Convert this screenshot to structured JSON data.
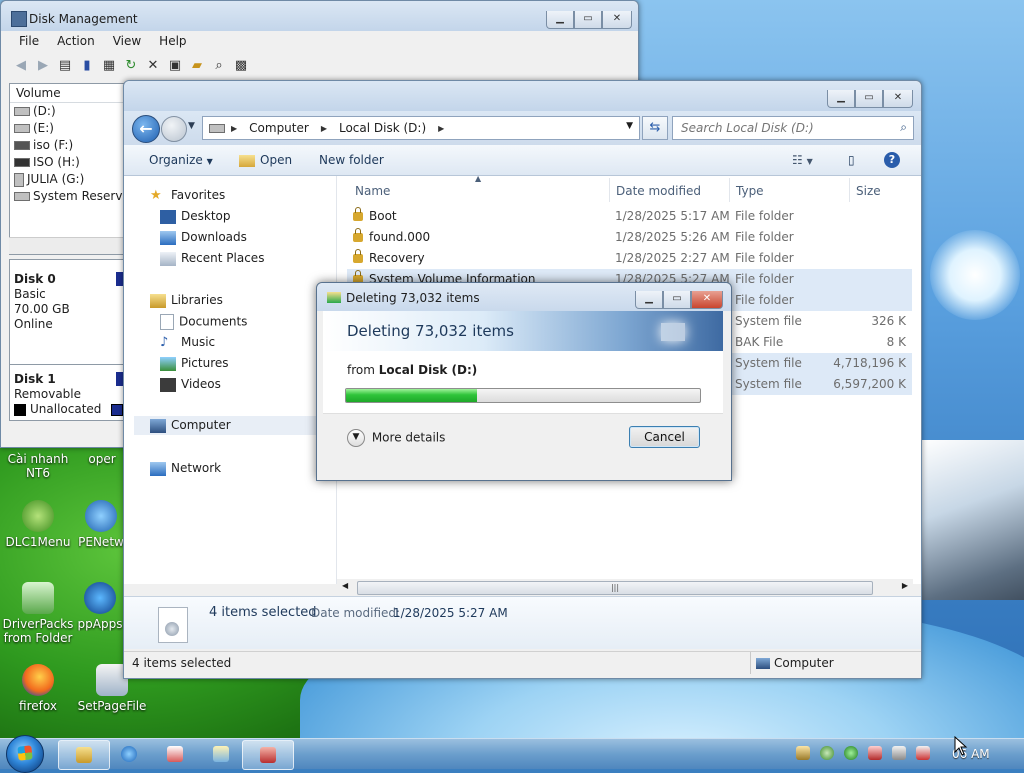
{
  "disk_management": {
    "title": "Disk Management",
    "menu": [
      "File",
      "Action",
      "View",
      "Help"
    ],
    "volume_header": "Volume",
    "volumes": [
      "(D:)",
      "(E:)",
      "iso (F:)",
      "ISO (H:)",
      "JULIA (G:)",
      "System Reserved"
    ],
    "disk0": {
      "name": "Disk 0",
      "type": "Basic",
      "size": "70.00 GB",
      "status": "Online"
    },
    "disk1": {
      "name": "Disk 1",
      "type": "Removable"
    },
    "legend_unallocated": "Unallocated",
    "legend_p": "P"
  },
  "explorer": {
    "breadcrumb": [
      "Computer",
      "Local Disk (D:)"
    ],
    "search_placeholder": "Search Local Disk (D:)",
    "commands": {
      "organize": "Organize",
      "open": "Open",
      "new_folder": "New folder"
    },
    "nav": {
      "favorites": "Favorites",
      "desktop": "Desktop",
      "downloads": "Downloads",
      "recent_places": "Recent Places",
      "libraries": "Libraries",
      "documents": "Documents",
      "music": "Music",
      "pictures": "Pictures",
      "videos": "Videos",
      "computer": "Computer",
      "network": "Network"
    },
    "columns": {
      "name": "Name",
      "date": "Date modified",
      "type": "Type",
      "size": "Size"
    },
    "rows": [
      {
        "name": "Boot",
        "date": "1/28/2025 5:17 AM",
        "type": "File folder",
        "size": ""
      },
      {
        "name": "found.000",
        "date": "1/28/2025 5:26 AM",
        "type": "File folder",
        "size": ""
      },
      {
        "name": "Recovery",
        "date": "1/28/2025 2:27 AM",
        "type": "File folder",
        "size": ""
      },
      {
        "name": "System Volume Information",
        "date": "1/28/2025 5:27 AM",
        "type": "File folder",
        "size": ""
      },
      {
        "name": "",
        "date": "",
        "type": "File folder",
        "size": ""
      },
      {
        "name": "",
        "date": "",
        "type": "System file",
        "size": "326 K"
      },
      {
        "name": "",
        "date": "",
        "type": "BAK File",
        "size": "8 K"
      },
      {
        "name": "",
        "date": "",
        "type": "System file",
        "size": "4,718,196 K"
      },
      {
        "name": "",
        "date": "",
        "type": "System file",
        "size": "6,597,200 K"
      }
    ],
    "details_count": "4 items selected",
    "details_date_label": "Date modified:",
    "details_date_value": "1/28/2025 5:27 AM",
    "status_left": "4 items selected",
    "status_right": "Computer"
  },
  "dialog": {
    "title": "Deleting 73,032 items",
    "heading": "Deleting 73,032 items",
    "from_label": "from",
    "from_value": "Local Disk (D:)",
    "progress_percent": 37,
    "more_details": "More details",
    "cancel": "Cancel"
  },
  "desktop_icons": [
    {
      "label": "Cài nhanh NT6"
    },
    {
      "label": "oper"
    },
    {
      "label": "DLC1Menu"
    },
    {
      "label": "PENetw"
    },
    {
      "label": "DriverPacks from Folder"
    },
    {
      "label": "ppApps"
    },
    {
      "label": "firefox"
    },
    {
      "label": "SetPageFile"
    }
  ],
  "taskbar": {
    "clock": "06 AM"
  }
}
